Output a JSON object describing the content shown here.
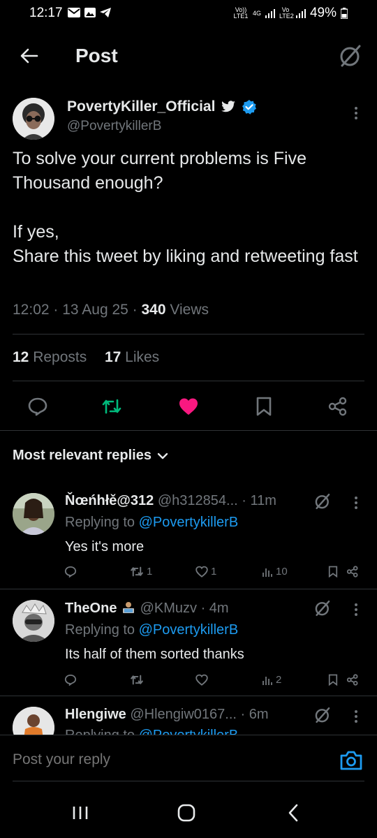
{
  "status_bar": {
    "time": "12:17",
    "battery": "49%",
    "net_left": "Vo)) LTE1",
    "net_4g": "4G",
    "net_right": "Vo LTE2"
  },
  "header": {
    "title": "Post"
  },
  "tweet": {
    "author_name": "PovertyKiller_Official",
    "handle": "@PovertykillerB",
    "text": "To solve your current problems is Five Thousand enough?\n\nIf yes,\nShare this tweet by liking and retweeting fast",
    "time": "12:02",
    "date": "13 Aug 25",
    "views_count": "340",
    "views_label": "Views",
    "reposts_count": "12",
    "reposts_label": "Reposts",
    "likes_count": "17",
    "likes_label": "Likes"
  },
  "colors": {
    "accent": "#1d9bf0",
    "repost_green": "#00ba7c",
    "like_pink": "#f91880",
    "muted": "#71767b"
  },
  "replies_section": {
    "title": "Most relevant replies"
  },
  "replies": [
    {
      "name": "Ňœńhłě@312",
      "handle": "@h312854...",
      "time": "· 11m",
      "replying_prefix": "Replying to",
      "replying_to": "@PovertykillerB",
      "text": "Yes it's more",
      "reposts": "1",
      "likes": "1",
      "views": "10"
    },
    {
      "name": "TheOne",
      "handle": "@KMuzv",
      "time": "· 4m",
      "replying_prefix": "Replying to",
      "replying_to": "@PovertykillerB",
      "text": "Its half of them sorted thanks",
      "reposts": "",
      "likes": "",
      "views": "2"
    },
    {
      "name": "Hlengiwe",
      "handle": "@Hlengiw0167...",
      "time": "· 6m",
      "replying_prefix": "Replying to",
      "replying_to": "@PovertykillerB"
    }
  ],
  "composer": {
    "placeholder": "Post your reply"
  }
}
